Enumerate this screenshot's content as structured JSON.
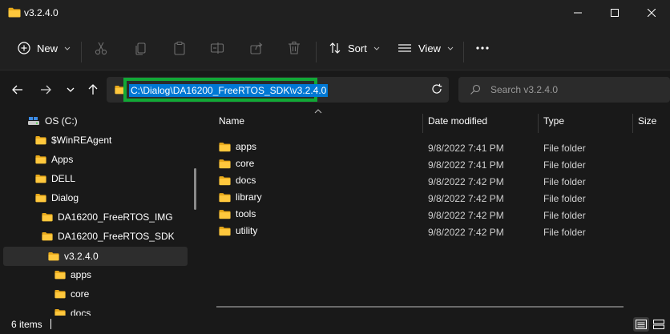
{
  "window": {
    "title": "v3.2.4.0"
  },
  "commandbar": {
    "new_label": "New",
    "sort_label": "Sort",
    "view_label": "View",
    "more_label": "···"
  },
  "address": {
    "path": "C:\\Dialog\\DA16200_FreeRTOS_SDK\\v3.2.4.0",
    "highlight_color": "#11a936",
    "selection_color": "#0078d4"
  },
  "search": {
    "placeholder": "Search v3.2.4.0"
  },
  "navpane": {
    "items": [
      {
        "label": "OS (C:)",
        "icon": "drive-icon"
      },
      {
        "label": "$WinREAgent",
        "icon": "folder-icon"
      },
      {
        "label": "Apps",
        "icon": "folder-icon"
      },
      {
        "label": "DELL",
        "icon": "folder-icon"
      },
      {
        "label": "Dialog",
        "icon": "folder-icon"
      },
      {
        "label": "DA16200_FreeRTOS_IMG",
        "icon": "folder-icon"
      },
      {
        "label": "DA16200_FreeRTOS_SDK",
        "icon": "folder-icon"
      },
      {
        "label": "v3.2.4.0",
        "icon": "folder-icon",
        "selected": true
      },
      {
        "label": "apps",
        "icon": "folder-icon"
      },
      {
        "label": "core",
        "icon": "folder-icon"
      },
      {
        "label": "docs",
        "icon": "folder-icon"
      }
    ]
  },
  "columns": {
    "name": "Name",
    "date": "Date modified",
    "type": "Type",
    "size": "Size"
  },
  "files": [
    {
      "name": "apps",
      "date": "9/8/2022 7:41 PM",
      "type": "File folder"
    },
    {
      "name": "core",
      "date": "9/8/2022 7:41 PM",
      "type": "File folder"
    },
    {
      "name": "docs",
      "date": "9/8/2022 7:42 PM",
      "type": "File folder"
    },
    {
      "name": "library",
      "date": "9/8/2022 7:42 PM",
      "type": "File folder"
    },
    {
      "name": "tools",
      "date": "9/8/2022 7:42 PM",
      "type": "File folder"
    },
    {
      "name": "utility",
      "date": "9/8/2022 7:42 PM",
      "type": "File folder"
    }
  ],
  "status": {
    "item_count": "6 items"
  }
}
